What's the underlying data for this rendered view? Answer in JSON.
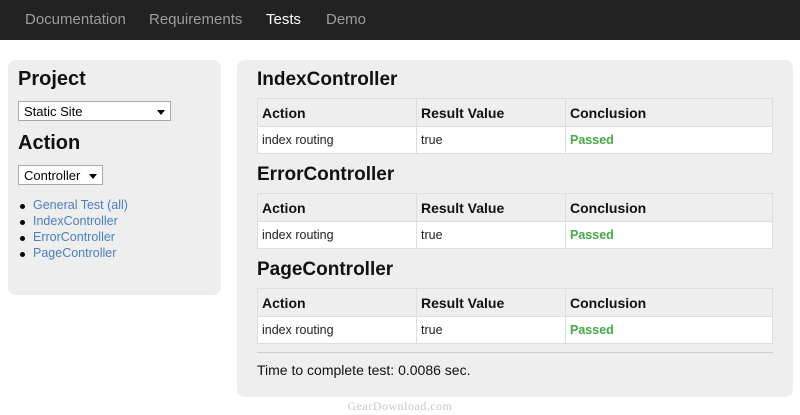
{
  "nav": {
    "items": [
      {
        "label": "Documentation",
        "active": false
      },
      {
        "label": "Requirements",
        "active": false
      },
      {
        "label": "Tests",
        "active": true
      },
      {
        "label": "Demo",
        "active": false
      }
    ]
  },
  "sidebar": {
    "project_heading": "Project",
    "project_select": "Static Site",
    "action_heading": "Action",
    "action_select": "Controller",
    "links": [
      "General Test (all)",
      "IndexController",
      "ErrorController",
      "PageController"
    ]
  },
  "main": {
    "columns": [
      "Action",
      "Result Value",
      "Conclusion"
    ],
    "sections": [
      {
        "title": "IndexController",
        "rows": [
          {
            "action": "index routing",
            "result": "true",
            "conclusion": "Passed"
          }
        ]
      },
      {
        "title": "ErrorController",
        "rows": [
          {
            "action": "index routing",
            "result": "true",
            "conclusion": "Passed"
          }
        ]
      },
      {
        "title": "PageController",
        "rows": [
          {
            "action": "index routing",
            "result": "true",
            "conclusion": "Passed"
          }
        ]
      }
    ],
    "timing": "Time to complete test: 0.0086 sec."
  },
  "colors": {
    "navbar": "#222222",
    "panel": "#eeeeee",
    "link": "#4a7fc0",
    "passed": "#44aa44"
  },
  "watermark": "GearDownload.com"
}
